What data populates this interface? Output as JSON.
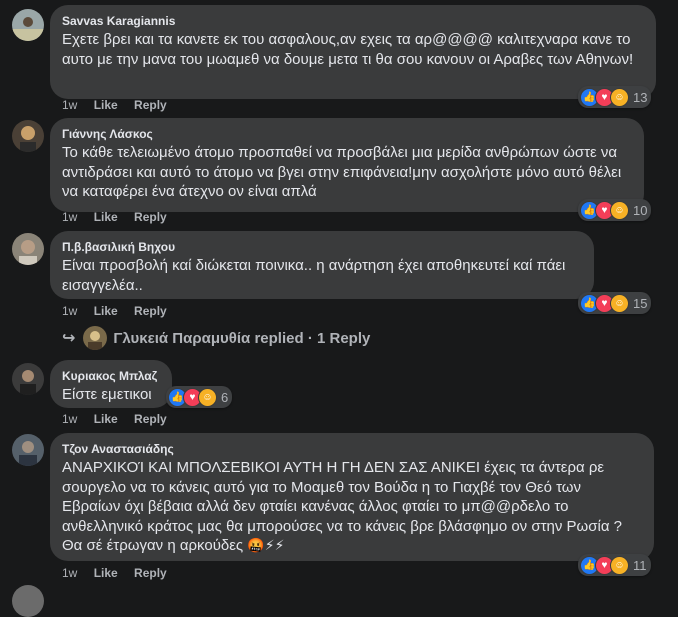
{
  "comments": [
    {
      "name": "Savvas Karagiannis",
      "text": "Εχετε βρει και τα κανετε εκ του ασφαλους,αν εχεις τα αρ@@@@ καλιτεχναρα κανε το αυτο με την μανα του μωαμεθ να δουμε μετα τι θα σου κανουν οι Αραβες των Αθηνων!",
      "time": "1w",
      "like": "Like",
      "reply": "Reply",
      "reaction_count": "13"
    },
    {
      "name": "Γιάννης Λάσκος",
      "text": "Το κάθε τελειωμένο άτομο προσπαθεί να προσβάλει μια μερίδα ανθρώπων ώστε να αντιδράσει και αυτό το άτομο να βγει στην επιφάνεια!μην ασχολήστε μόνο αυτό θέλει να καταφέρει ένα άτεχνο ον είναι απλά",
      "time": "1w",
      "like": "Like",
      "reply": "Reply",
      "reaction_count": "10"
    },
    {
      "name": "Π.β.βασιλική Βηχου",
      "text": "Είναι προσβολή καί διώκεται ποινικα.. η ανάρτηση έχει αποθηκευτεί καί πάει εισαγγελέα..",
      "time": "1w",
      "like": "Like",
      "reply": "Reply",
      "reaction_count": "15"
    },
    {
      "name": "Κυριακος Μπλαζ",
      "text": "Είστε εμετικοι",
      "time": "1w",
      "like": "Like",
      "reply": "Reply",
      "reaction_count": "6"
    },
    {
      "name": "Τζον Αναστασιάδης",
      "text": "ΑΝΑΡΧΙΚΟΊ ΚΑΙ ΜΠΟΛΣΕΒΙΚΟΙ ΑΥΤΗ Η ΓΗ ΔΕΝ ΣΑΣ ΑΝΙΚΕΙ έχεις τα άντερα ρε σουργελο να το κάνεις αυτό για το Μοαμεθ τον Βούδα η το Γιαχβέ τον Θεό των Εβραίων όχι βέβαια αλλά δεν φταίει κανένας άλλος φταίει το μπ@@ρδελο το ανθελληνικό κράτος μας θα μπορούσες να το κάνεις βρε βλάσφημο ον στην Ρωσία ? Θα σέ έτρωγαν η αρκούδες",
      "emojis": "🤬⚡⚡",
      "time": "1w",
      "like": "Like",
      "reply": "Reply",
      "reaction_count": "11"
    }
  ],
  "reply_summary": {
    "name": "Γλυκειά Παραμυθία",
    "text": "replied",
    "separator": "·",
    "count": "1 Reply"
  },
  "colors": {
    "background": "#18191a",
    "bubble": "#3a3b3c",
    "text": "#e4e6eb",
    "secondary": "#b0b3b8",
    "like": "#2078f4",
    "love": "#f33e58",
    "haha": "#f7b125"
  },
  "icons": [
    "like-reaction-icon",
    "love-reaction-icon",
    "haha-reaction-icon",
    "reply-arrow-icon"
  ]
}
